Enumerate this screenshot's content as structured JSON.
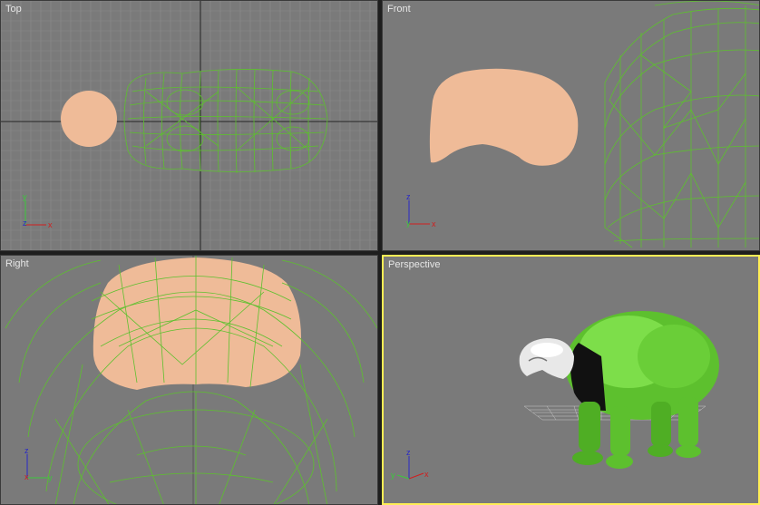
{
  "viewports": [
    {
      "label": "Top"
    },
    {
      "label": "Front"
    },
    {
      "label": "Right"
    },
    {
      "label": "Perspective"
    }
  ],
  "axes": {
    "x": "x",
    "y": "y",
    "z": "z"
  },
  "colors": {
    "background": "#7a7a7a",
    "grid": "#8c8c8c",
    "wireframe": "#5dc02e",
    "skin": "#efbb98",
    "active_border": "#ffee55",
    "axis_x": "#d21e1e",
    "axis_y": "#3cc83c",
    "axis_z": "#2828c8"
  }
}
